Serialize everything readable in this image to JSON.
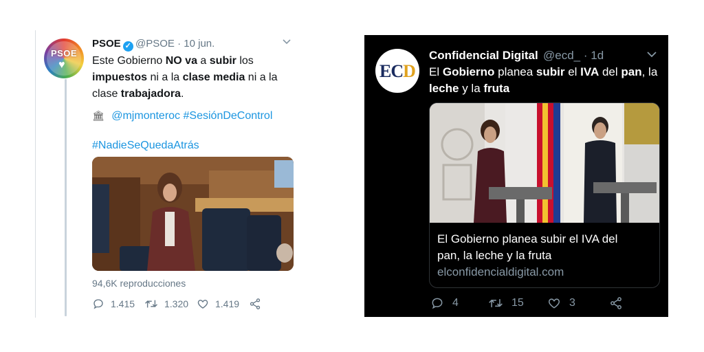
{
  "left_tweet": {
    "display_name": "PSOE",
    "verified": true,
    "handle": "@PSOE",
    "date": "10 jun.",
    "avatar_text": "PSOE",
    "text_segments": [
      {
        "t": "Este Gobierno ",
        "b": false
      },
      {
        "t": "NO va",
        "b": true
      },
      {
        "t": " a ",
        "b": false
      },
      {
        "t": "subir",
        "b": true
      },
      {
        "t": " los ",
        "b": false
      },
      {
        "t": "impuestos",
        "b": true
      },
      {
        "t": " ni a la ",
        "b": false
      },
      {
        "t": "clase media",
        "b": true
      },
      {
        "t": " ni a la clase ",
        "b": false
      },
      {
        "t": "trabajadora",
        "b": true
      },
      {
        "t": ".",
        "b": false
      }
    ],
    "mention": "@mjmonteroc",
    "hashtag_1": "#SesiónDeControl",
    "hashtag_2": "#NadieSeQuedaAtrás",
    "views": "94,6K reproducciones",
    "replies": "1.415",
    "retweets": "1.320",
    "likes": "1.419",
    "link_color": "#1b95e0"
  },
  "right_tweet": {
    "display_name": "Confidencial Digital",
    "handle": "@ecd_",
    "date": "1d",
    "avatar_text_main": "EC",
    "avatar_text_accent": "D",
    "text_segments": [
      {
        "t": "El ",
        "b": false
      },
      {
        "t": "Gobierno",
        "b": true
      },
      {
        "t": " planea ",
        "b": false
      },
      {
        "t": "subir",
        "b": true
      },
      {
        "t": " el ",
        "b": false
      },
      {
        "t": "IVA",
        "b": true
      },
      {
        "t": " del ",
        "b": false
      },
      {
        "t": "pan",
        "b": true
      },
      {
        "t": ", la ",
        "b": false
      },
      {
        "t": "leche",
        "b": true
      },
      {
        "t": " y la ",
        "b": false
      },
      {
        "t": "fruta",
        "b": true
      }
    ],
    "card_title": "El Gobierno planea subir el IVA del pan, la leche y la fruta",
    "card_domain": "elconfidencialdigital.com",
    "replies": "4",
    "retweets": "15",
    "likes": "3",
    "background": "#000000"
  }
}
